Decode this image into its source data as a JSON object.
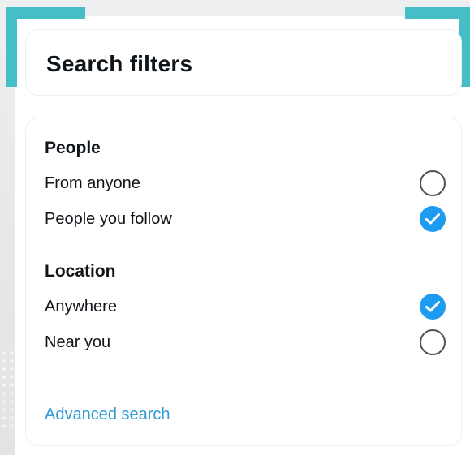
{
  "header": {
    "title": "Search filters"
  },
  "sections": [
    {
      "heading": "People",
      "options": [
        {
          "label": "From anyone",
          "selected": false
        },
        {
          "label": "People you follow",
          "selected": true
        }
      ]
    },
    {
      "heading": "Location",
      "options": [
        {
          "label": "Anywhere",
          "selected": true
        },
        {
          "label": "Near you",
          "selected": false
        }
      ]
    }
  ],
  "advanced_link": "Advanced search",
  "colors": {
    "accent": "#46bec7",
    "selected": "#1d9bf0",
    "link": "#2f9ad6",
    "text": "#0f1419"
  },
  "icons": {
    "selected": "check-circle-icon",
    "unselected": "empty-circle-icon"
  }
}
